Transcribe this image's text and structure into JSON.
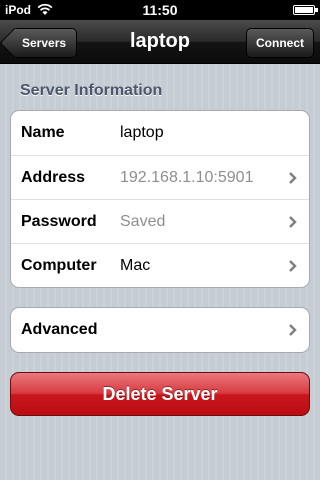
{
  "status_bar": {
    "carrier": "iPod",
    "time": "11:50",
    "wifi_icon": "wifi-icon",
    "battery_icon": "battery-icon",
    "battery_level": 1.0
  },
  "nav": {
    "back_label": "Servers",
    "title": "laptop",
    "right_label": "Connect"
  },
  "section_header": "Server Information",
  "info_rows": [
    {
      "label": "Name",
      "value": "laptop"
    },
    {
      "label": "Address",
      "value": "192.168.1.10:5901"
    },
    {
      "label": "Password",
      "value": "Saved"
    },
    {
      "label": "Computer",
      "value": "Mac"
    }
  ],
  "advanced_label": "Advanced",
  "delete_label": "Delete Server",
  "colors": {
    "background": "#c5ccd4",
    "section_header": "#4c566c",
    "delete_red": "#c8161d",
    "placeholder_gray": "#8e8e8e"
  }
}
